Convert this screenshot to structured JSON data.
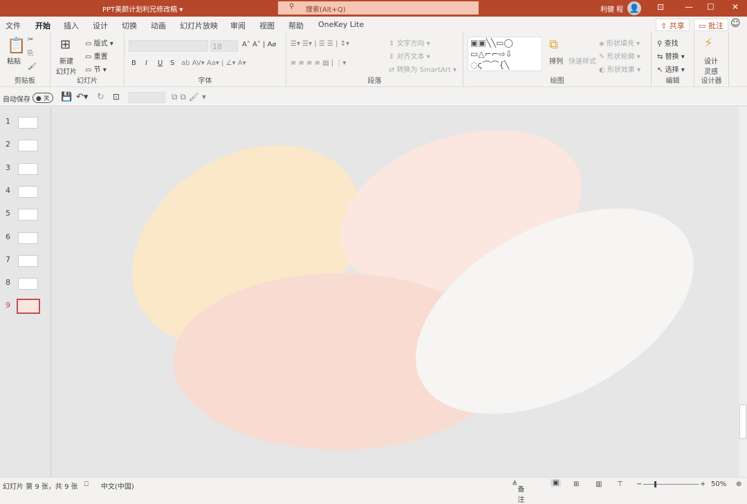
{
  "titlebar": {
    "title": "PPT美颜计划利兄修改稿 ▾",
    "search_placeholder": "搜索(Alt+Q)",
    "user": "利健 程"
  },
  "tabs": [
    "文件",
    "开始",
    "插入",
    "设计",
    "切换",
    "动画",
    "幻灯片放映",
    "审阅",
    "视图",
    "帮助",
    "OneKey Lite"
  ],
  "active_tab": "开始",
  "actions": {
    "share": "共享",
    "comment": "批注"
  },
  "ribbon": {
    "clipboard": {
      "paste": "粘贴",
      "label": "剪贴板"
    },
    "slides": {
      "new_slide": "新建\n幻灯片",
      "layout": "版式",
      "reset": "重置",
      "section": "节",
      "label": "幻灯片"
    },
    "font": {
      "size": "18",
      "bold": "B",
      "italic": "I",
      "underline": "U",
      "strike": "S",
      "label": "字体"
    },
    "paragraph": {
      "text_direction": "文字方向",
      "align_text": "对齐文本",
      "smartart": "转换为 SmartArt",
      "label": "段落"
    },
    "drawing": {
      "arrange": "排列",
      "quick_styles": "快速样式",
      "fill": "形状填充",
      "outline": "形状轮廓",
      "effects": "形状效果",
      "label": "绘图"
    },
    "editing": {
      "find": "查找",
      "replace": "替换",
      "select": "选择",
      "label": "编辑"
    },
    "designer": {
      "ideas": "设计\n灵感",
      "label": "设计器"
    }
  },
  "qat": {
    "autosave": "自动保存",
    "toggle": "关"
  },
  "slides": [
    "1",
    "2",
    "3",
    "4",
    "5",
    "6",
    "7",
    "8",
    "9"
  ],
  "current_slide": 9,
  "status": {
    "slide_info": "幻灯片 第 9 张，共 9 张",
    "language": "中文(中国)",
    "notes": "备注",
    "zoom": "50%"
  },
  "colors": {
    "accent": "#b7472a",
    "yellow": "#fae8c8",
    "peach": "#fbe7df",
    "pink": "#f8dcd2",
    "white": "#f6f5f3"
  }
}
